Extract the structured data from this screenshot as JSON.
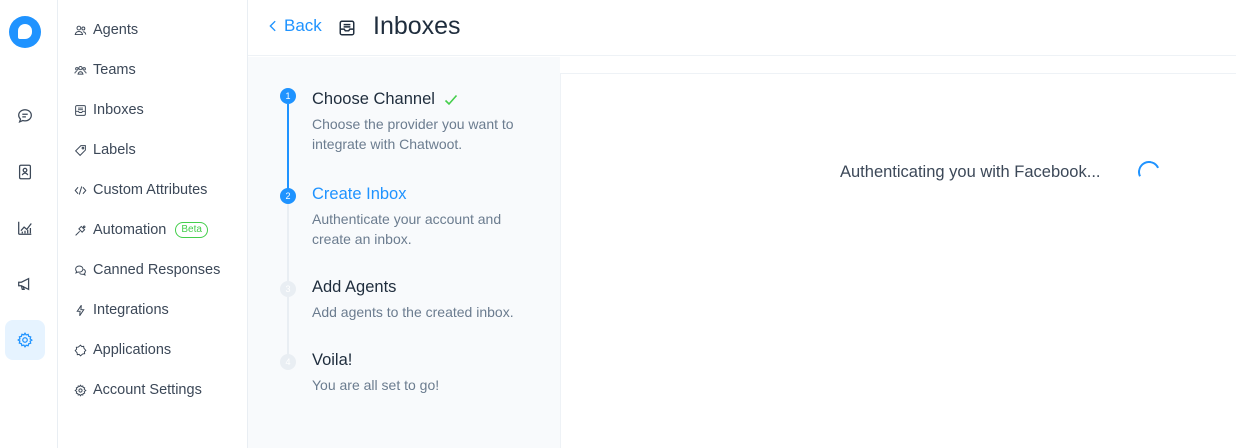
{
  "rail": {
    "items": [
      {
        "icon": "chat-bubble-icon"
      },
      {
        "icon": "contacts-book-icon"
      },
      {
        "icon": "reports-chart-icon"
      },
      {
        "icon": "megaphone-icon"
      },
      {
        "icon": "gear-icon",
        "active": true
      }
    ]
  },
  "sidebar": {
    "items": [
      {
        "label": "Agents",
        "icon": "agents-icon"
      },
      {
        "label": "Teams",
        "icon": "teams-icon"
      },
      {
        "label": "Inboxes",
        "icon": "inbox-icon"
      },
      {
        "label": "Labels",
        "icon": "tag-icon"
      },
      {
        "label": "Custom Attributes",
        "icon": "code-icon"
      },
      {
        "label": "Automation",
        "icon": "automation-icon",
        "badge": "Beta"
      },
      {
        "label": "Canned Responses",
        "icon": "chat-multiple-icon"
      },
      {
        "label": "Integrations",
        "icon": "flash-icon"
      },
      {
        "label": "Applications",
        "icon": "star-badge-icon"
      },
      {
        "label": "Account Settings",
        "icon": "settings-icon"
      }
    ]
  },
  "header": {
    "back_label": "Back",
    "title": "Inboxes"
  },
  "wizard": {
    "steps": [
      {
        "number": "1",
        "title": "Choose Channel",
        "description": "Choose the provider you want to integrate with Chatwoot.",
        "status": "done"
      },
      {
        "number": "2",
        "title": "Create Inbox",
        "description": "Authenticate your account and create an inbox.",
        "status": "current"
      },
      {
        "number": "3",
        "title": "Add Agents",
        "description": "Add agents to the created inbox.",
        "status": "todo"
      },
      {
        "number": "4",
        "title": "Voila!",
        "description": "You are all set to go!",
        "status": "todo"
      }
    ]
  },
  "main": {
    "status_text": "Authenticating you with Facebook..."
  },
  "colors": {
    "accent": "#1f93ff",
    "success": "#44ce4b"
  }
}
